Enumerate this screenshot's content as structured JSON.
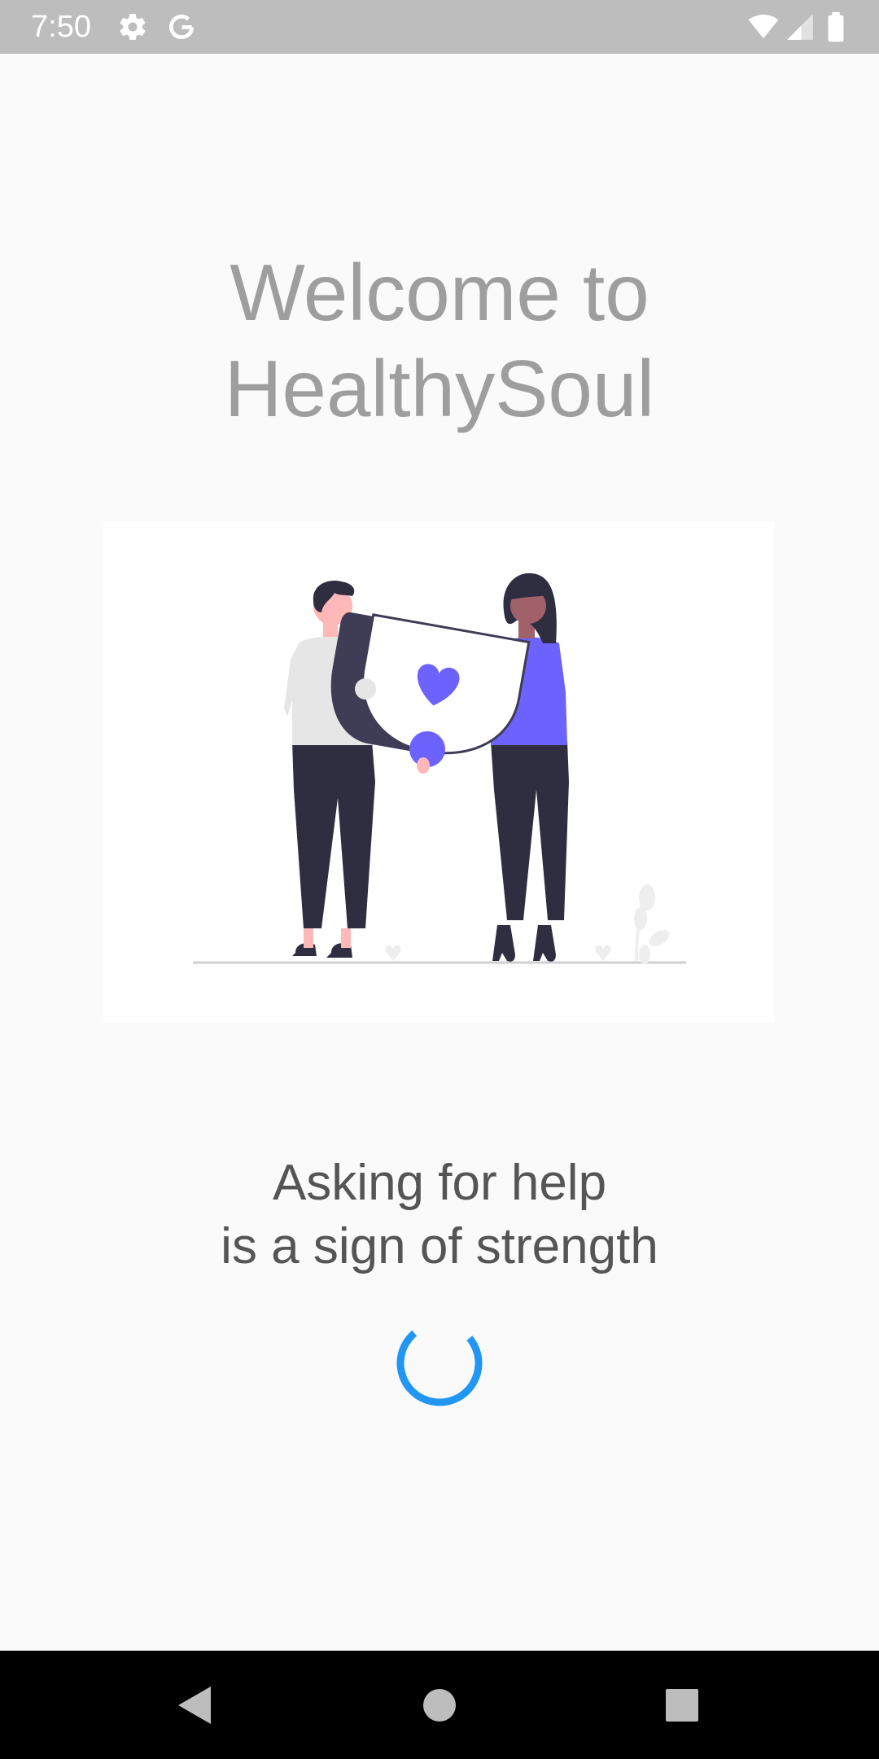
{
  "status_bar": {
    "time": "7:50",
    "icons_left": [
      "settings-icon",
      "google-icon"
    ],
    "icons_right": [
      "wifi-icon",
      "signal-icon",
      "battery-icon"
    ],
    "background_color": "#bdbdbd"
  },
  "welcome": {
    "line1": "Welcome to",
    "line2": "HealthySoul",
    "color": "#9e9e9e"
  },
  "illustration": {
    "description_icon": "two-people-holding-heart-card-illustration",
    "accent_color": "#6c63ff"
  },
  "tagline": {
    "line1": "Asking for help",
    "line2": "is a sign of strength",
    "color": "#555555"
  },
  "loading": {
    "icon": "loading-spinner-icon",
    "color": "#2196f3"
  },
  "navigation_bar": {
    "buttons": [
      "back-icon",
      "home-icon",
      "recents-icon"
    ]
  }
}
